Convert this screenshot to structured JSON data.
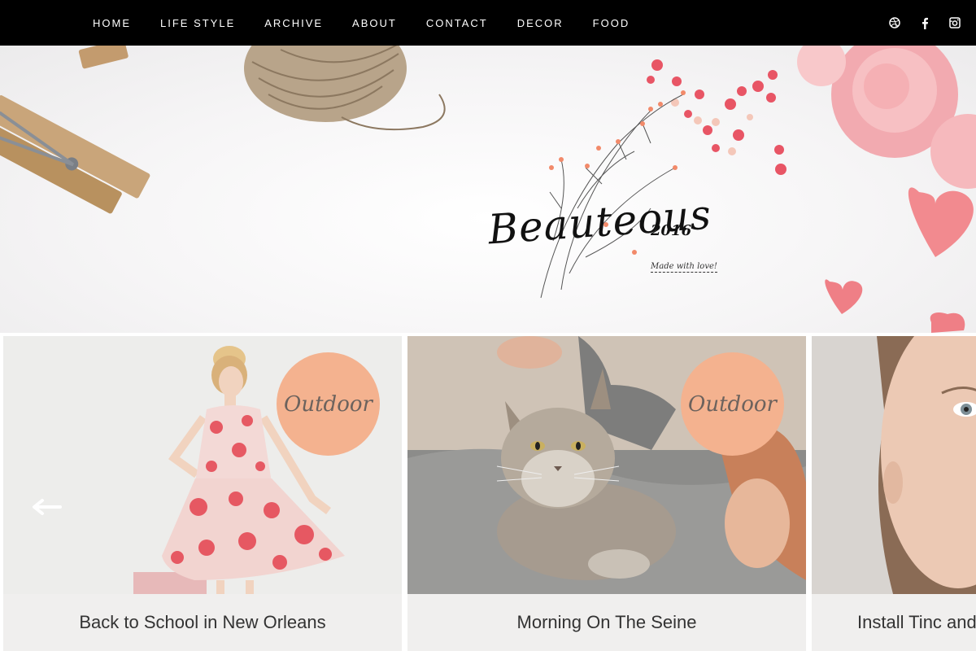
{
  "nav": {
    "items": [
      {
        "label": "HOME"
      },
      {
        "label": "LIFE STYLE"
      },
      {
        "label": "ARCHIVE"
      },
      {
        "label": "ABOUT"
      },
      {
        "label": "CONTACT"
      },
      {
        "label": "DECOR"
      },
      {
        "label": "FOOD"
      }
    ],
    "social": [
      "dribbble-icon",
      "facebook-icon",
      "instagram-icon"
    ]
  },
  "hero": {
    "logo_title": "Beauteous",
    "logo_year": "2016",
    "tagline": "Made with love!"
  },
  "carousel": {
    "slides": [
      {
        "title": "Back to School in New Orleans",
        "badge": "Outdoor"
      },
      {
        "title": "Morning On The Seine",
        "badge": "Outdoor"
      },
      {
        "title": "Install Tinc and"
      }
    ]
  },
  "colors": {
    "nav_bg": "#000000",
    "badge": "#f4b28f",
    "caption_bg": "#f0efee"
  }
}
